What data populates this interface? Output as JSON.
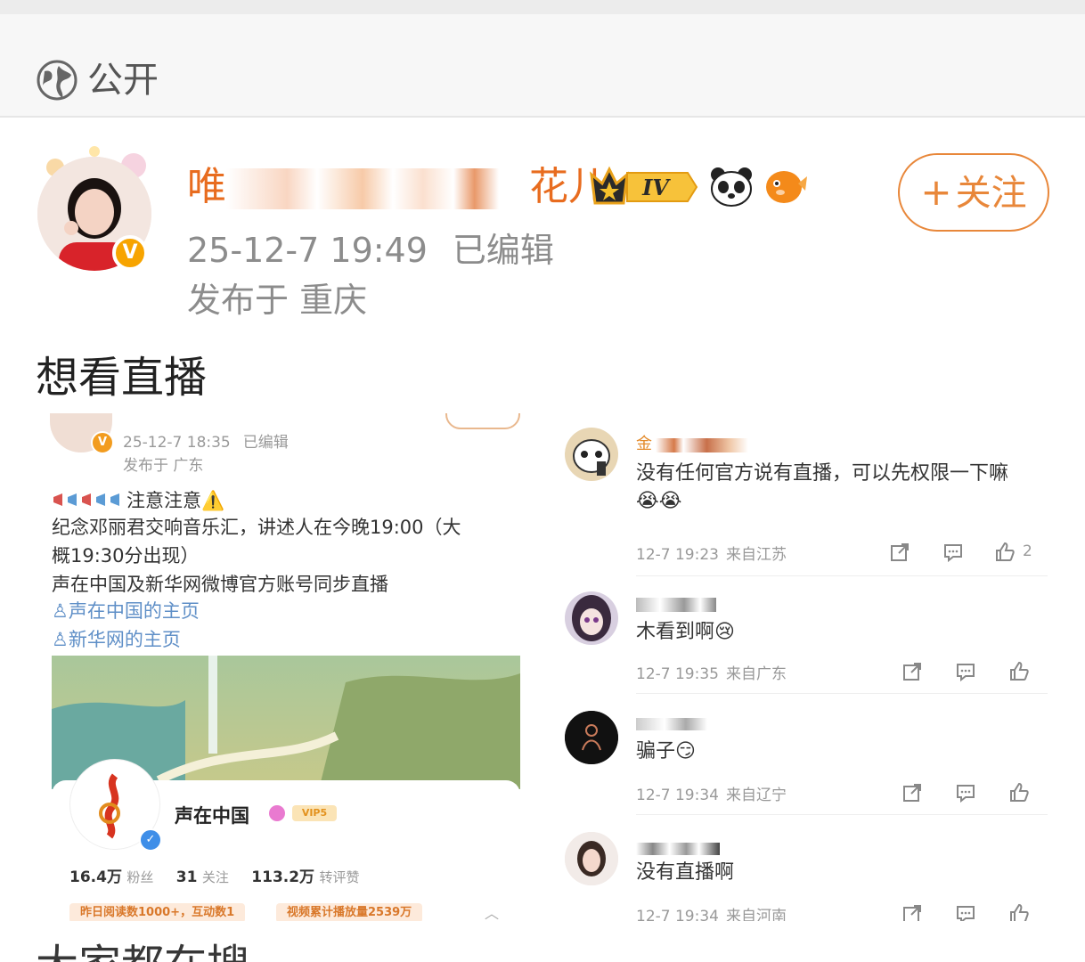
{
  "visibility": {
    "icon": "globe-icon",
    "label": "公开"
  },
  "post": {
    "author": {
      "name_start": "唯",
      "name_end": "花儿",
      "level_badge": "IV",
      "verified_badge": "V"
    },
    "follow_label": "关注",
    "time": "25-12-7 19:49",
    "edited": "已编辑",
    "location": "发布于 重庆",
    "text": "想看直播"
  },
  "embedded_post": {
    "time": "25-12-7 18:35",
    "edited": "已编辑",
    "location": "发布于 广东",
    "lines": [
      "注意注意⚠️",
      "纪念邓丽君交响音乐汇，讲述人在今晚19:00（大",
      "概19:30分出现）",
      "声在中国及新华网微博官方账号同步直播"
    ],
    "links": [
      "声在中国的主页",
      "新华网的主页"
    ],
    "profile_card": {
      "name": "声在中国",
      "vip": "VIP5",
      "stats": [
        {
          "value": "16.4万",
          "label": "粉丝"
        },
        {
          "value": "31",
          "label": "关注"
        },
        {
          "value": "113.2万",
          "label": "转评赞"
        }
      ],
      "pills": [
        "昨日阅读数1000+，互动数1",
        "视频累计播放量2539万"
      ]
    }
  },
  "comments": [
    {
      "name": "金",
      "text": "没有任何官方说有直播，可以先权限一下嘛😭😭",
      "time": "12-7 19:23",
      "source": "来自江苏",
      "likes": "2"
    },
    {
      "name": "",
      "text": "木看到啊😢",
      "time": "12-7 19:35",
      "source": "来自广东",
      "likes": ""
    },
    {
      "name": "",
      "text": "骗子😏",
      "time": "12-7 19:34",
      "source": "来自辽宁",
      "likes": ""
    },
    {
      "name": "",
      "text": "没有直播啊",
      "time": "12-7 19:34",
      "source": "来自河南",
      "likes": ""
    }
  ],
  "footer_peek": "大家都在搜",
  "colors": {
    "accent": "#e8873a",
    "name": "#e86c1f",
    "meta": "#8c8c8c",
    "link": "#5f8fc7"
  }
}
